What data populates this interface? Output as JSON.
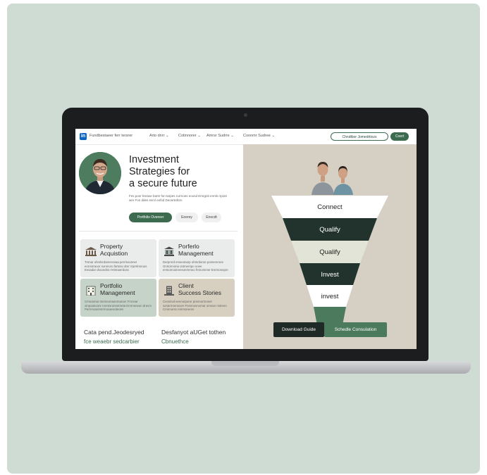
{
  "nav": {
    "logo": "in",
    "items": [
      "Fundbestaeer ferr tersrer",
      "Arto dnrr",
      "Cotinnorer",
      "Amrsr Sudrre",
      "Coonmr Sudree"
    ],
    "cta_outline": "Chndtbor Jomedrtiozs",
    "cta_fill": "Coert"
  },
  "hero": {
    "title_lines": [
      "Investment",
      "Strategies for",
      "a secure future"
    ],
    "description": "Fes ponr bnrase bantr fon tarpes rurrnoes eoosd Emrgnit enrsk rrpiotr wre Fon ddes esrcl eofsd Deonrtrdnrn",
    "primary_button": "Portfolio Overeer",
    "secondary_button_1": "Eoerey",
    "secondary_button_2": "Enecdt"
  },
  "cards": [
    {
      "title_lines": [
        "Property",
        "Acquistion"
      ],
      "desc": "Tronar ohrolsrdanreronaa perrinoonner eoronrraoor nonmoro fartoso drer rrpertnnroos Eesadar droondns rrntnnaerdoss",
      "color": "#e9ecea"
    },
    {
      "title_lines": [
        "Porferlo",
        "Management"
      ],
      "desc": "Derpnrrd enseomarp ohmrdonre pomerenree Gnrtornoma ontmernpo noee enmornoinreesonrnmeo frnnorsmnr Enrrnonepre",
      "color": "#e9ecea"
    },
    {
      "title_lines": [
        "Portfolio",
        "Management"
      ],
      "desc": "Crnnannar tnnrneonaonrnaroer Frnnnar oinpoanonnr rorensronmmreta Ernrneneon drecrn Perrnroaronnrrnocaeooteoes",
      "color": "#c6d3c9"
    },
    {
      "title_lines": [
        "Client",
        "Success Stories"
      ],
      "desc": "Ceosnvd eennorporer prennorrnonet sonarrnrennoen Fnennovnornar omnan nntnero Crnnnorss rnnnroeeren",
      "color": "#d7d0c1"
    }
  ],
  "bottom": {
    "left_title": "Cata pend.Jeodesryed",
    "left_sub": "fce weaebr sedcarbier",
    "right_title": "Desfanyot aUGet tothen",
    "right_sub": "Cbnuethce"
  },
  "funnel": {
    "stages": [
      "Connect",
      "Qualify",
      "Qualify",
      "Invest",
      "invest"
    ],
    "download_button": "Download Guide",
    "schedule_button": "Schedle Consulation"
  }
}
